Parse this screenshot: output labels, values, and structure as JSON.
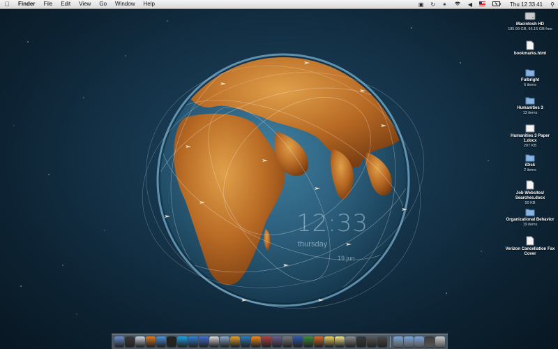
{
  "menubar": {
    "app_name": "Finder",
    "menus": [
      "File",
      "Edit",
      "View",
      "Go",
      "Window",
      "Help"
    ],
    "clock": "Thu 12 33 41",
    "extras": [
      "display-icon",
      "sync-icon",
      "bluetooth-icon",
      "wifi-icon",
      "volume-icon",
      "us-flag-icon",
      "battery-icon"
    ]
  },
  "clock_widget": {
    "time": "12:33",
    "day": "thursday",
    "date": "19 jun"
  },
  "desktop_icons": [
    {
      "label": "Macintosh HD",
      "sub": "185.99 GB, 66.15 GB free",
      "icon": "hard-drive-icon"
    },
    {
      "label": "bookmarks.html",
      "sub": "",
      "icon": "document-icon"
    },
    {
      "label": "Fulbright",
      "sub": "6 items",
      "icon": "folder-icon"
    },
    {
      "label": "Humanities 3",
      "sub": "13 items",
      "icon": "folder-icon"
    },
    {
      "label": "Humanities 3 Paper 1.docx",
      "sub": "207 KB",
      "icon": "document-icon"
    },
    {
      "label": "iDisk",
      "sub": "2 items",
      "icon": "folder-icon"
    },
    {
      "label": "Job Websites/ Searches.docx",
      "sub": "50 KB",
      "icon": "document-icon"
    },
    {
      "label": "Organizational Behavior",
      "sub": "19 items",
      "icon": "folder-icon"
    },
    {
      "label": "Verizon Cancellation Fax Cover",
      "sub": "",
      "icon": "document-icon"
    }
  ],
  "dock": {
    "items": [
      {
        "name": "finder-icon",
        "color": "#6c8fd0"
      },
      {
        "name": "dashboard-icon",
        "color": "#3a3a3a"
      },
      {
        "name": "mail-icon",
        "color": "#c9d4e0"
      },
      {
        "name": "firefox-icon",
        "color": "#e07a22"
      },
      {
        "name": "safari-icon",
        "color": "#4a90d9"
      },
      {
        "name": "terminal-icon",
        "color": "#222222"
      },
      {
        "name": "skype-icon",
        "color": "#1ba1e2"
      },
      {
        "name": "chat-icon",
        "color": "#2e7fd2"
      },
      {
        "name": "itunes-icon",
        "color": "#3f6fcf"
      },
      {
        "name": "ical-icon",
        "color": "#d9d9d9"
      },
      {
        "name": "preview-icon",
        "color": "#8aa8c8"
      },
      {
        "name": "photos-icon",
        "color": "#e0a030"
      },
      {
        "name": "globe-app-icon",
        "color": "#2d7ab8"
      },
      {
        "name": "vlc-icon",
        "color": "#f08a1c"
      },
      {
        "name": "chess-icon",
        "color": "#b04040"
      },
      {
        "name": "script-icon",
        "color": "#6c5c8c"
      },
      {
        "name": "tools-icon",
        "color": "#7a7a7a"
      },
      {
        "name": "word-icon",
        "color": "#2b5aa8"
      },
      {
        "name": "excel-icon",
        "color": "#3c8a3c"
      },
      {
        "name": "powerpoint-icon",
        "color": "#d06a2a"
      },
      {
        "name": "notes-icon",
        "color": "#e8d060"
      },
      {
        "name": "stickies-icon",
        "color": "#f0e28a"
      },
      {
        "name": "system-prefs-icon",
        "color": "#8a8a8a"
      },
      {
        "name": "activity-icon",
        "color": "#3a3a3a"
      },
      {
        "name": "calculator-icon",
        "color": "#5a5a5a"
      },
      {
        "name": "grapher-icon",
        "color": "#4a4a4a"
      }
    ],
    "stack_items": [
      {
        "name": "applications-folder-icon",
        "color": "#7aa4d8"
      },
      {
        "name": "documents-folder-icon",
        "color": "#7aa4d8"
      },
      {
        "name": "downloads-folder-icon",
        "color": "#7aa4d8"
      },
      {
        "name": "screen-icon",
        "color": "#3a3a3a"
      },
      {
        "name": "trash-icon",
        "color": "#c4c8cc"
      }
    ]
  }
}
